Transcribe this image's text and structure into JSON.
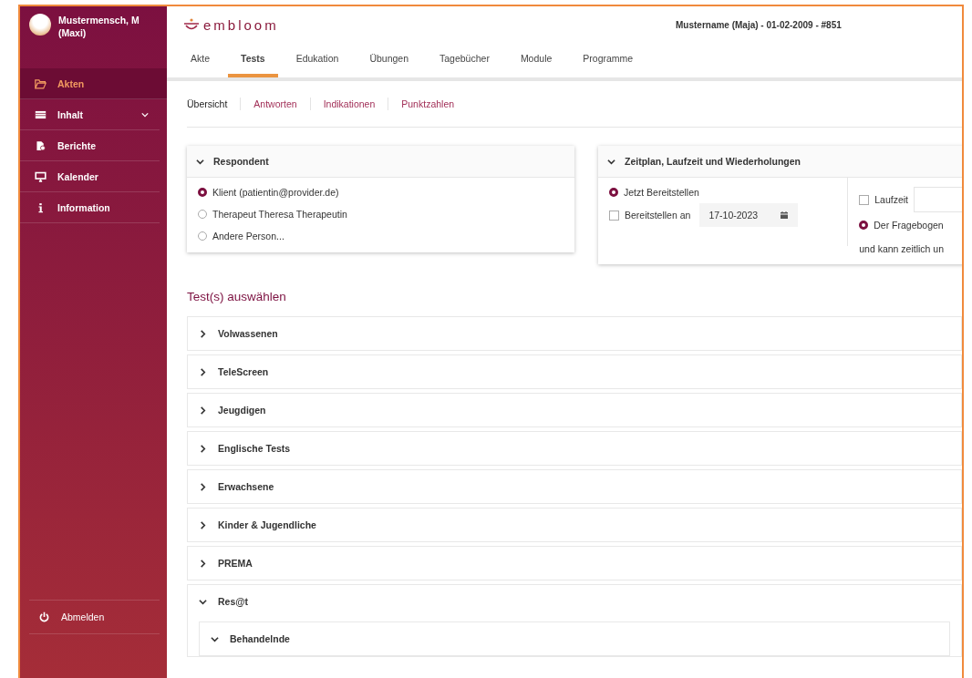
{
  "sidebar": {
    "user": {
      "name": "Mustermensch, M",
      "nickname": "(Maxi)"
    },
    "items": [
      {
        "label": "Akten",
        "kind": "folder",
        "selected": true,
        "expandable": false
      },
      {
        "label": "Inhalt",
        "kind": "table",
        "selected": false,
        "expandable": true
      },
      {
        "label": "Berichte",
        "kind": "report",
        "selected": false,
        "expandable": false
      },
      {
        "label": "Kalender",
        "kind": "monitor",
        "selected": false,
        "expandable": false
      },
      {
        "label": "Information",
        "kind": "info",
        "selected": false,
        "expandable": false
      }
    ],
    "logout": {
      "label": "Abmelden"
    }
  },
  "header": {
    "logo": "embloom",
    "patient": "Mustername (Maja) - 01-02-2009 - #851"
  },
  "tabs": [
    {
      "label": "Akte",
      "selected": false
    },
    {
      "label": "Tests",
      "selected": true
    },
    {
      "label": "Edukation",
      "selected": false
    },
    {
      "label": "Übungen",
      "selected": false
    },
    {
      "label": "Tagebücher",
      "selected": false
    },
    {
      "label": "Module",
      "selected": false
    },
    {
      "label": "Programme",
      "selected": false
    }
  ],
  "subtabs": [
    {
      "label": "Übersicht",
      "selected": true
    },
    {
      "label": "Antworten",
      "selected": false
    },
    {
      "label": "Indikationen",
      "selected": false
    },
    {
      "label": "Punktzahlen",
      "selected": false
    }
  ],
  "respondent": {
    "title": "Respondent",
    "expanded": true,
    "options": [
      {
        "label": "Klient (patientin@provider.de)",
        "selected": true
      },
      {
        "label": "Therapeut Theresa Therapeutin",
        "selected": false
      },
      {
        "label": "Andere Person...",
        "selected": false
      }
    ]
  },
  "schedule": {
    "title": "Zeitplan, Laufzeit und Wiederholungen",
    "expanded": true,
    "now": {
      "label": "Jetzt Bereitstellen",
      "selected": true
    },
    "at": {
      "label": "Bereitstellen an",
      "checked": false,
      "date": "17-10-2023"
    },
    "runtime": {
      "label": "Laufzeit",
      "checked": false
    },
    "questionnaire": {
      "label": "Der Fragebogen",
      "selected": true
    },
    "note": "und kann zeitlich un"
  },
  "tests_title": "Test(s) auswählen",
  "test_groups": [
    {
      "label": "Volwassenen",
      "expanded": false
    },
    {
      "label": "TeleScreen",
      "expanded": false
    },
    {
      "label": "Jeugdigen",
      "expanded": false
    },
    {
      "label": "Englische Tests",
      "expanded": false
    },
    {
      "label": "Erwachsene",
      "expanded": false
    },
    {
      "label": "Kinder & Jugendliche",
      "expanded": false
    },
    {
      "label": "PREMA",
      "expanded": false
    },
    {
      "label": "Res@t",
      "expanded": true,
      "children": [
        {
          "label": "Behandelnde",
          "expanded": true
        }
      ]
    }
  ]
}
